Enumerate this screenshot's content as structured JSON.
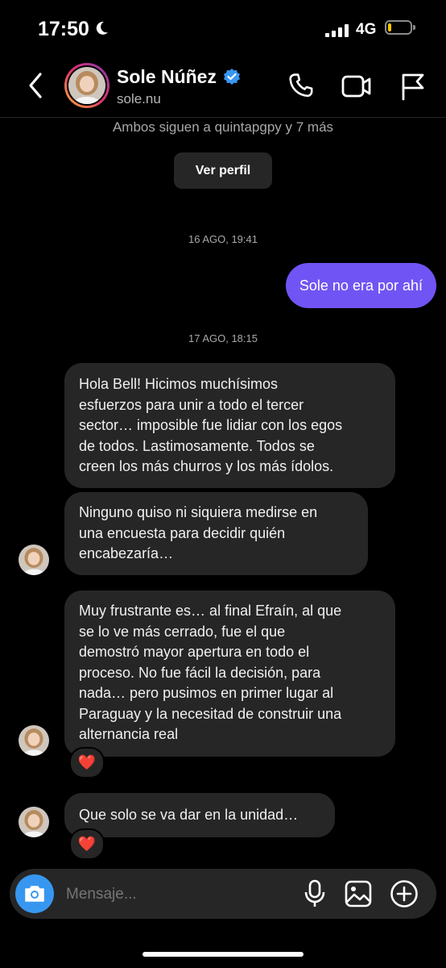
{
  "status_bar": {
    "time": "17:50",
    "network": "4G",
    "battery_percent": 15,
    "battery_color": "#f6c700"
  },
  "header": {
    "name": "Sole Núñez",
    "username": "sole.nu",
    "verified": true,
    "icons": [
      "back-icon",
      "phone-icon",
      "video-icon",
      "flag-icon"
    ]
  },
  "profile": {
    "mutual_text": "Ambos siguen a quintapgpy y 7 más",
    "view_profile_label": "Ver perfil"
  },
  "messages": [
    {
      "type": "date",
      "text": "16 AGO, 19:41"
    },
    {
      "type": "outgoing",
      "text": "Sole no era por ahí"
    },
    {
      "type": "date",
      "text": "17 AGO, 18:15"
    },
    {
      "type": "incoming",
      "lines": [
        "Hola Bell! Hicimos muchísimos",
        "esfuerzos para unir a todo el tercer",
        "sector… imposible fue lidiar con los egos",
        "de todos. Lastimosamente. Todos se",
        "creen los más churros y los más ídolos."
      ]
    },
    {
      "type": "incoming",
      "lines": [
        "Ninguno quiso ni siquiera medirse en",
        "una encuesta para decidir quién",
        "encabezaría…"
      ]
    },
    {
      "type": "incoming",
      "lines": [
        "Muy frustrante es… al final Efraín, al que",
        "se lo ve más cerrado, fue el que",
        "demostró mayor apertura en todo el",
        "proceso. No fue fácil la decisión, para",
        "nada… pero pusimos en primer lugar al",
        "Paraguay y la necesitad de construir una",
        "alternancia real"
      ],
      "reaction": "❤️"
    },
    {
      "type": "incoming",
      "lines": [
        "Que solo se va dar en la unidad…"
      ],
      "reaction": "❤️"
    }
  ],
  "composer": {
    "placeholder": "Mensaje..."
  },
  "colors": {
    "outgoing_bubble": "#7154f4",
    "incoming_bubble": "#262626",
    "camera_button": "#3797f0",
    "verified_badge": "#3797f0"
  }
}
